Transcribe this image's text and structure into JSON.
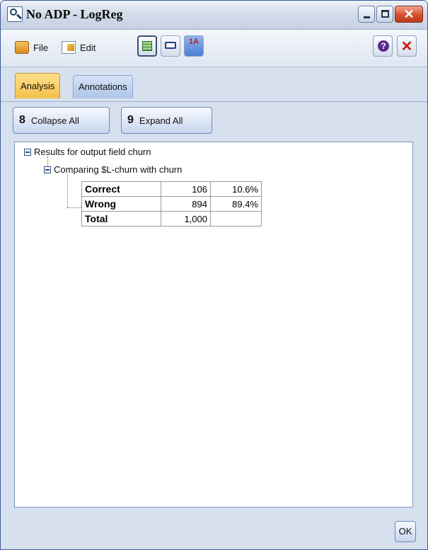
{
  "window": {
    "title": "No ADP - LogReg"
  },
  "menu": {
    "file": "File",
    "edit": "Edit"
  },
  "toolbar": {
    "sort_label": "1A"
  },
  "tabs": [
    {
      "label": "Analysis",
      "active": true
    },
    {
      "label": "Annotations",
      "active": false
    }
  ],
  "actions": {
    "collapse_all": "Collapse All",
    "expand_all": "Expand All"
  },
  "tree": {
    "root_label": "Results for output field churn",
    "child_label": "Comparing $L-churn with churn",
    "rows": [
      {
        "label": "Correct",
        "count": "106",
        "percent": "10.6%"
      },
      {
        "label": "Wrong",
        "count": "894",
        "percent": "89.4%"
      },
      {
        "label": "Total",
        "count": "1,000",
        "percent": ""
      }
    ]
  },
  "footer": {
    "ok_label": "OK"
  },
  "colors": {
    "active_tab": "#f4c04a",
    "close_button": "#d4502e",
    "frame": "#d7e0ee"
  }
}
